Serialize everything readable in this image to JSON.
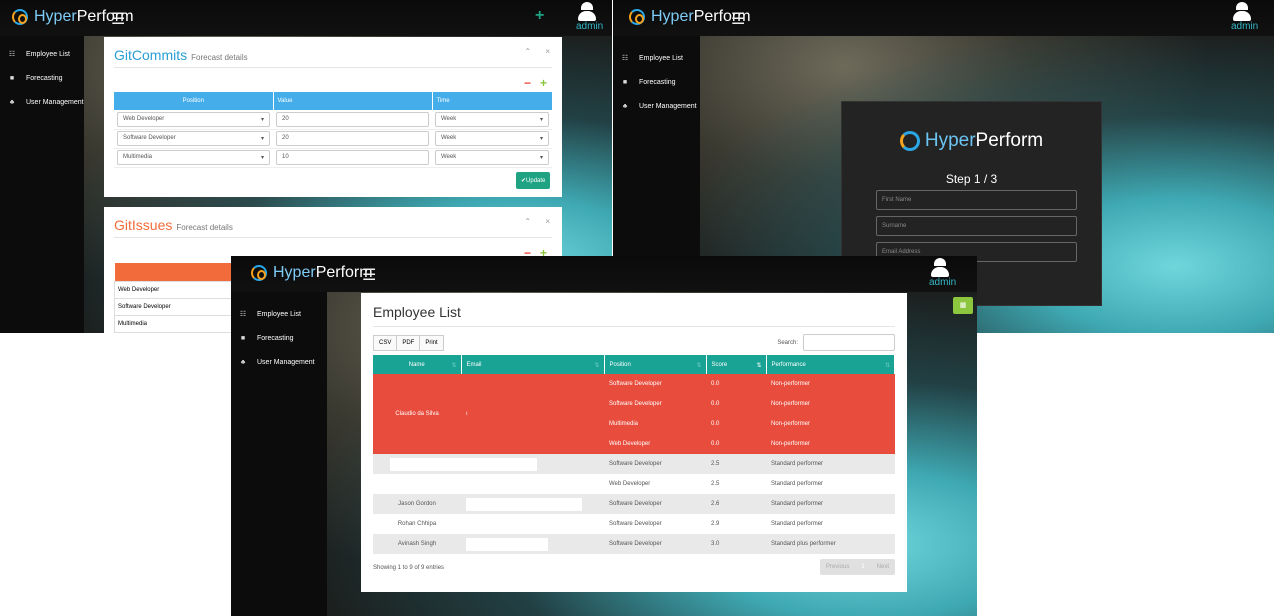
{
  "brand": {
    "light": "Hyper",
    "bold": "Perform"
  },
  "user": {
    "label": "admin"
  },
  "sidebar": {
    "items": [
      {
        "label": "Employee List",
        "icon": "users-icon"
      },
      {
        "label": "Forecasting",
        "icon": "briefcase-icon"
      },
      {
        "label": "User Management",
        "icon": "user-group-icon"
      }
    ]
  },
  "forecast": {
    "panels": [
      {
        "title": "GitCommits",
        "subtitle": "Forecast details",
        "color": "#2a9fd6",
        "headers": [
          "Position",
          "Value",
          "Time"
        ],
        "rows": [
          {
            "position": "Web Developer",
            "value": "20",
            "time": "Week"
          },
          {
            "position": "Software Developer",
            "value": "20",
            "time": "Week"
          },
          {
            "position": "Multimedia",
            "value": "10",
            "time": "Week"
          }
        ],
        "update_label": "✔Update"
      },
      {
        "title": "GitIssues",
        "subtitle": "Forecast details",
        "color": "#f26b3a",
        "headers": [
          "Position"
        ],
        "rows": [
          {
            "position": "Web Developer"
          },
          {
            "position": "Software Developer"
          },
          {
            "position": "Multimedia"
          }
        ]
      }
    ],
    "minus": "−",
    "plus": "+"
  },
  "signup": {
    "step": "Step 1 / 3",
    "fields": [
      "First Name",
      "Surname",
      "Email Address"
    ]
  },
  "employee_list": {
    "title": "Employee List",
    "export_buttons": [
      "CSV",
      "PDF",
      "Print"
    ],
    "search_label": "Search:",
    "columns": [
      "Name",
      "Email",
      "Position",
      "Score",
      "Performance"
    ],
    "rows": [
      {
        "name": "Claudio da Silva",
        "email": "",
        "position": "Software Developer",
        "score": "0.0",
        "performance": "Non-performer"
      },
      {
        "name": "",
        "email": "",
        "position": "Software Developer",
        "score": "0.0",
        "performance": "Non-performer"
      },
      {
        "name": "",
        "email": "",
        "position": "Multimedia",
        "score": "0.0",
        "performance": "Non-performer"
      },
      {
        "name": "",
        "email": "",
        "position": "Web Developer",
        "score": "0.0",
        "performance": "Non-performer"
      },
      {
        "name": "",
        "email": "",
        "position": "Software Developer",
        "score": "2.5",
        "performance": "Standard performer"
      },
      {
        "name": "",
        "email": "",
        "position": "Web Developer",
        "score": "2.5",
        "performance": "Standard performer"
      },
      {
        "name": "Jason Gordon",
        "email": "",
        "position": "Software Developer",
        "score": "2.6",
        "performance": "Standard performer"
      },
      {
        "name": "Rohan Chhipa",
        "email": "",
        "position": "Software Developer",
        "score": "2.9",
        "performance": "Standard performer"
      },
      {
        "name": "Avinash Singh",
        "email": "",
        "position": "Software Developer",
        "score": "3.0",
        "performance": "Standard plus performer"
      }
    ],
    "info": "Showing 1 to 9 of 9 entries",
    "pager": {
      "prev": "Previous",
      "page": "1",
      "next": "Next"
    }
  }
}
